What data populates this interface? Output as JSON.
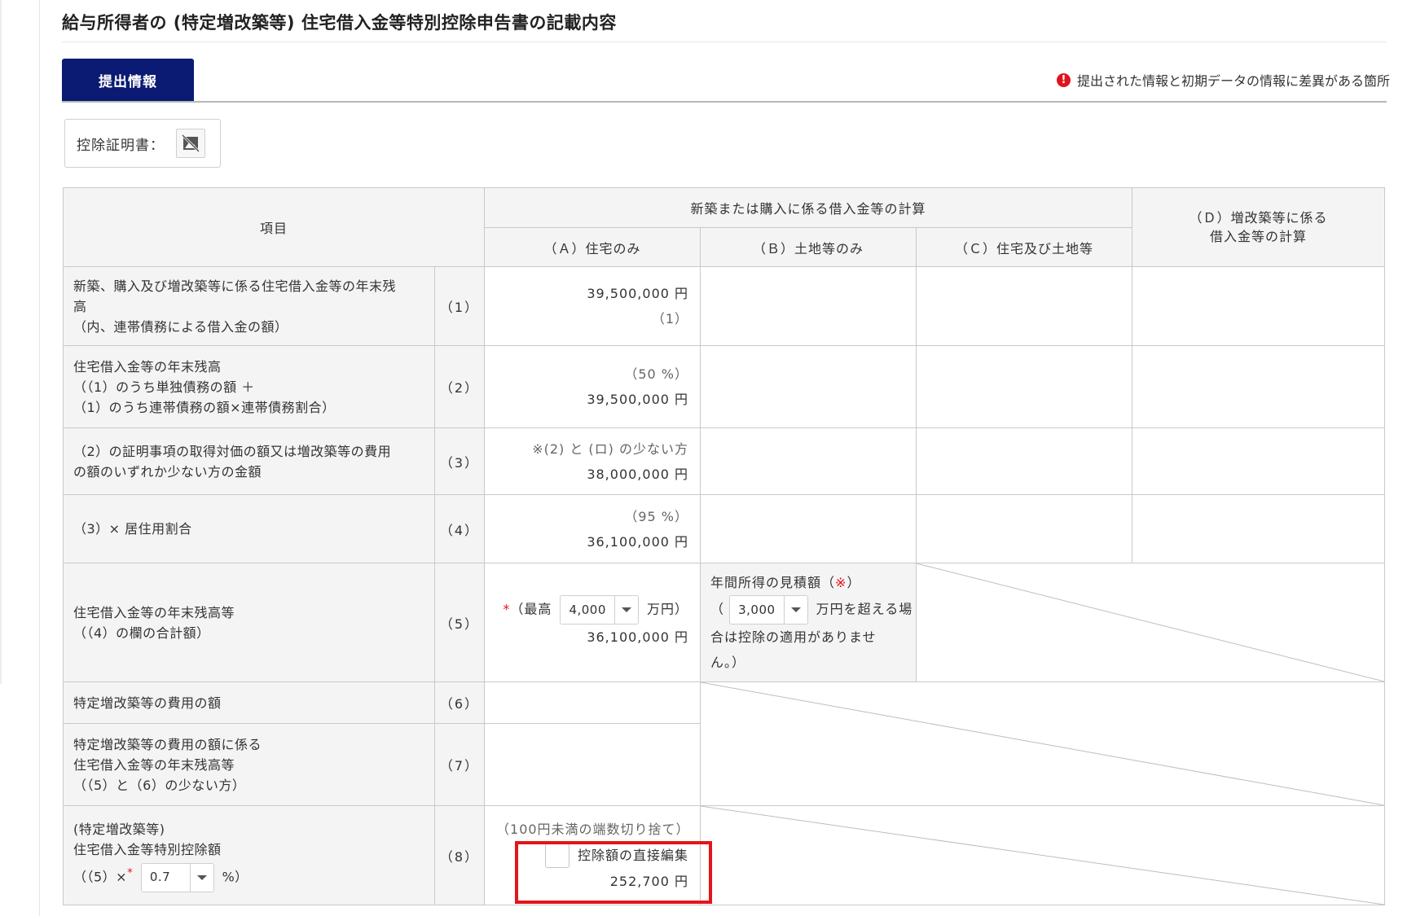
{
  "header": {
    "title": "給与所得者の (特定増改築等) 住宅借入金等特別控除申告書の記載内容",
    "tab_label": "提出情報",
    "diff_note": "提出された情報と初期データの情報に差異がある箇所",
    "diff_icon": "!"
  },
  "certificate": {
    "label": "控除証明書："
  },
  "table": {
    "head": {
      "item": "項目",
      "group": "新築または購入に係る借入金等の計算",
      "col_a": "（Ａ）住宅のみ",
      "col_b": "（Ｂ）土地等のみ",
      "col_c": "（Ｃ）住宅及び土地等",
      "col_d_line1": "（Ｄ）増改築等に係る",
      "col_d_line2": "借入金等の計算"
    },
    "row1": {
      "label_1": "新築、購入及び増改築等に係る住宅借入金等の年末残",
      "label_2": "高",
      "label_3": "（内、連帯債務による借入金の額）",
      "num": "（1）",
      "a_amount": "39,500,000 円",
      "a_sub": "（1）"
    },
    "row2": {
      "label_1": "住宅借入金等の年末残高",
      "label_2": "（（1）のうち単独債務の額 ＋",
      "label_3": "（1）のうち連帯債務の額×連帯債務割合）",
      "num": "（2）",
      "a_ratio": "（50 %）",
      "a_amount": "39,500,000 円"
    },
    "row3": {
      "label_1": "（2）の証明事項の取得対価の額又は増改築等の費用",
      "label_2": "の額のいずれか少ない方の金額",
      "num": "（3）",
      "a_note": "※(2) と (ロ) の少ない方",
      "a_amount": "38,000,000 円"
    },
    "row4": {
      "label_1": "（3）× 居住用割合",
      "num": "（4）",
      "a_ratio": "（95 %）",
      "a_amount": "36,100,000 円"
    },
    "row5": {
      "label_1": "住宅借入金等の年末残高等",
      "label_2": "（（4）の欄の合計額）",
      "num": "（5）",
      "a_req": "*",
      "a_prefix": "（最高",
      "a_select": "4,000",
      "a_suffix": "万円）",
      "a_amount": "36,100,000 円",
      "b_line1": "年間所得の見積額（",
      "b_req": "※",
      "b_line1_end": "）",
      "b_open": "（",
      "b_select": "3,000",
      "b_line2": "万円を超える場",
      "b_line3": "合は控除の適用がありませ",
      "b_line4": "ん。）"
    },
    "row6": {
      "label_1": "特定増改築等の費用の額",
      "num": "（6）"
    },
    "row7": {
      "label_1": "特定増改築等の費用の額に係る",
      "label_2": "住宅借入金等の年末残高等",
      "label_3": "（（5）と（6）の少ない方）",
      "num": "（7）"
    },
    "row8": {
      "label_1": "(特定増改築等)",
      "label_2": "住宅借入金等特別控除額",
      "label_3_prefix": "（（5）×",
      "label_req": "*",
      "label_select": "0.7",
      "label_3_suffix": "%）",
      "num": "（8）",
      "a_note": "（100円未満の端数切り捨て）",
      "a_checkbox_label": "控除額の直接編集",
      "a_amount": "252,700 円"
    }
  },
  "colors": {
    "tab_bg": "#0b1a72",
    "warn": "#e0141e",
    "highlight": "#e4141b"
  }
}
